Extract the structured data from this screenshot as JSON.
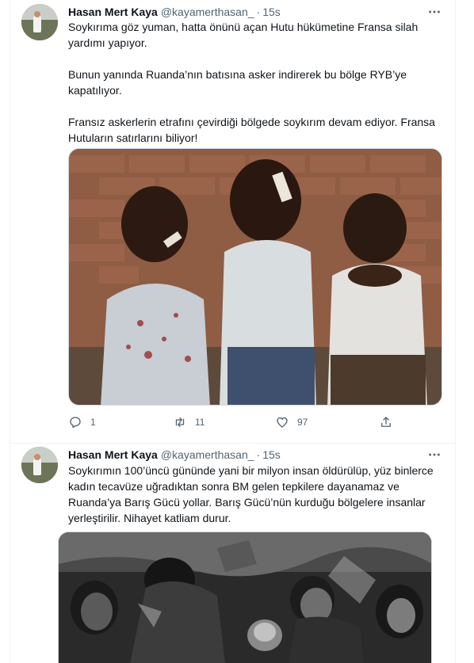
{
  "tweets": [
    {
      "author_name": "Hasan Mert Kaya",
      "author_handle": "@kayamerthasan_",
      "separator": "·",
      "time": "15s",
      "paragraphs": [
        "Soykırıma göz yuman, hatta önünü açan Hutu hükümetine Fransa silah yardımı yapıyor.",
        "Bunun yanında Ruanda’nın batısına asker indirerek bu bölge RYB’ye kapatılıyor.",
        "Fransız askerlerin etrafını çevirdiği bölgede soykırım devam ediyor. Fransa Hutuların satırlarını biliyor!"
      ],
      "actions": {
        "reply_count": "1",
        "retweet_count": "11",
        "like_count": "97"
      }
    },
    {
      "author_name": "Hasan Mert Kaya",
      "author_handle": "@kayamerthasan_",
      "separator": "·",
      "time": "15s",
      "paragraphs": [
        "Soykırımın 100’üncü gününde yani bir milyon insan öldürülüp, yüz binlerce kadın tecavüze uğradıktan sonra BM gelen tepkilere dayanamaz ve Ruanda’ya Barış Gücü yollar. Barış Gücü’nün kurduğu bölgelere insanlar yerleştirilir. Nihayet katliam durur."
      ]
    }
  ],
  "icons": {
    "more": "more-dots-icon",
    "reply": "reply-bubble-icon",
    "retweet": "retweet-icon",
    "like": "heart-icon",
    "share": "share-upload-icon"
  },
  "colors": {
    "text_primary": "#0f1419",
    "text_secondary": "#536471",
    "divider": "#eff3f4",
    "media_border": "#cfd9de"
  }
}
